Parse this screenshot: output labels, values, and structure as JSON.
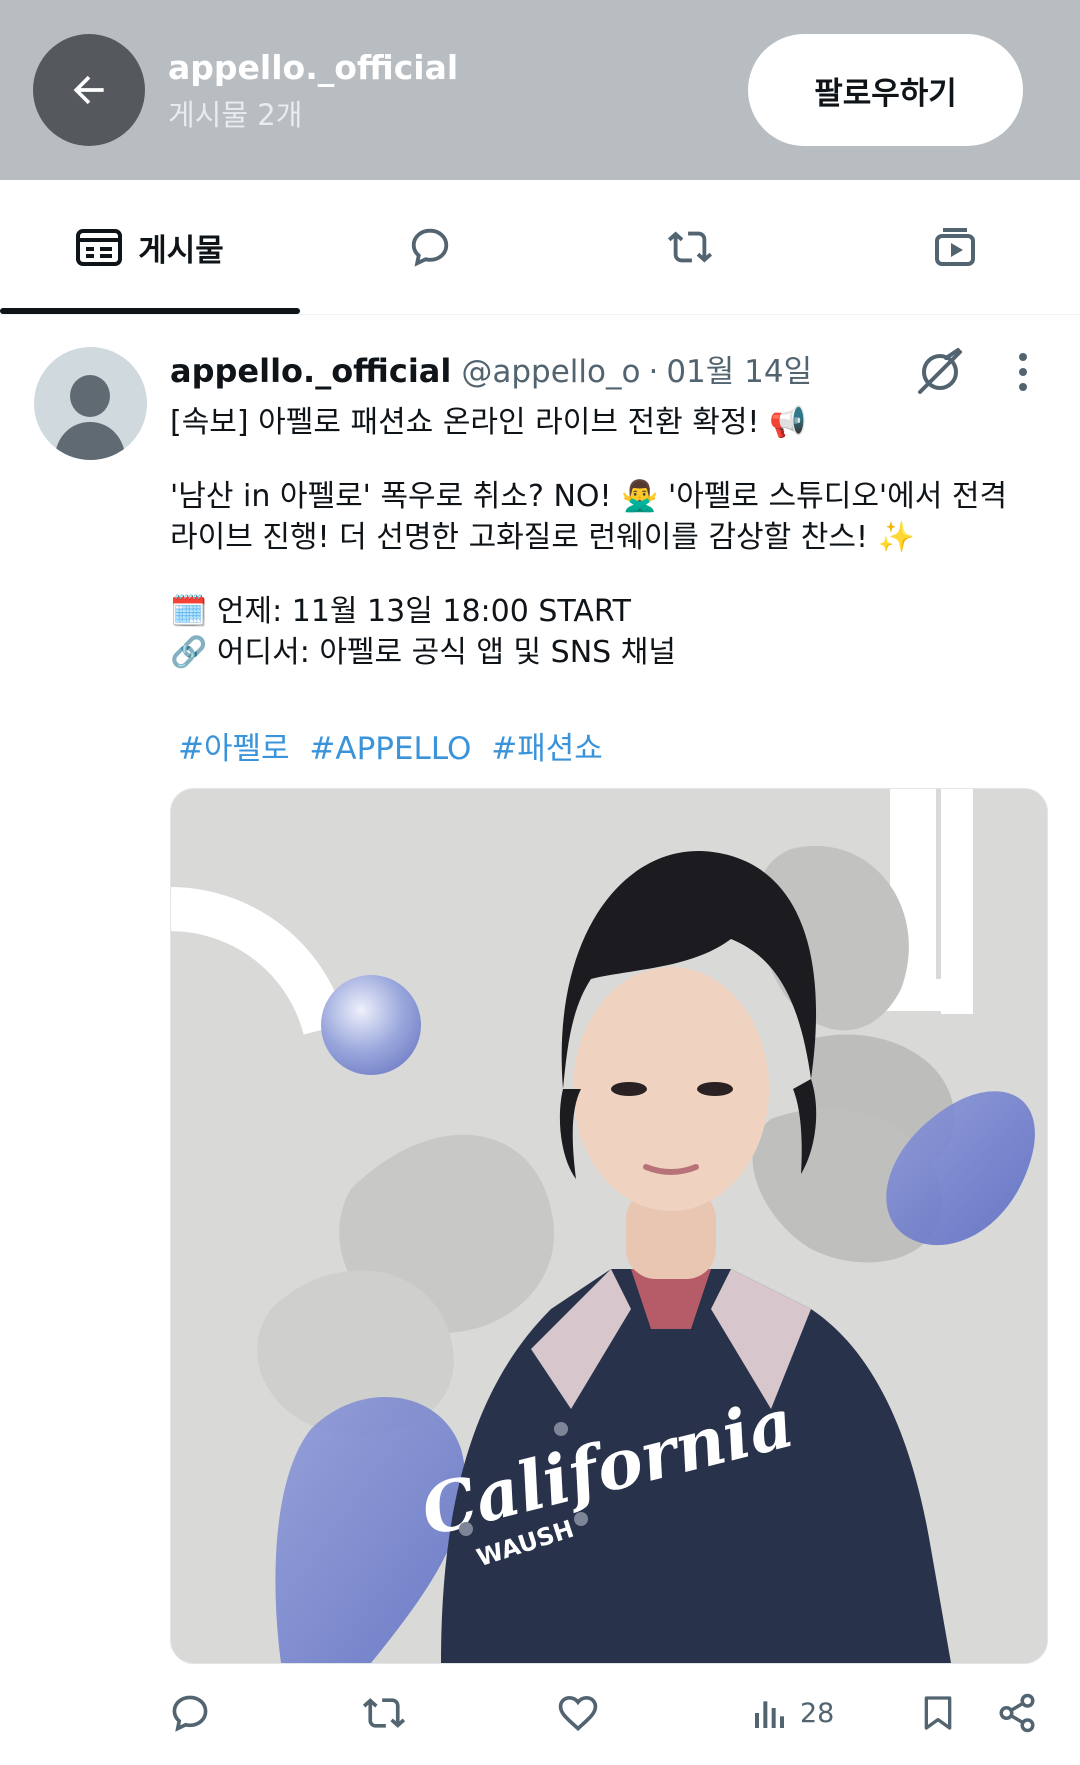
{
  "header": {
    "title": "appello._official",
    "subtitle": "게시물 2개",
    "follow_label": "팔로우하기"
  },
  "tabs": [
    {
      "label": "게시물",
      "icon": "posts-icon",
      "active": true
    },
    {
      "label": "",
      "icon": "replies-icon",
      "active": false
    },
    {
      "label": "",
      "icon": "retweet-icon",
      "active": false
    },
    {
      "label": "",
      "icon": "media-icon",
      "active": false
    }
  ],
  "post": {
    "author": "appello._official",
    "handle": "@appello_o",
    "separator": "·",
    "date": "01월 14일",
    "lines": [
      "[속보] 아펠로 패션쇼 온라인 라이브 전환 확정! 📢",
      "'남산 in 아펠로' 폭우로 취소? NO! 🙅‍♂️ '아펠로 스튜디오'에서 전격",
      "라이브 진행! 더 선명한 고화질로 런웨이를 감상할 찬스! ✨",
      "🗓️ 언제: 11월 13일 18:00 START",
      "🔗 어디서: 아펠로 공식 앱 및 SNS 채널"
    ],
    "hashtags": [
      "#아펠로",
      "#APPELLO",
      "#패션쇼"
    ],
    "media_logo_text": "California",
    "media_logo_sub": "WAUSH"
  },
  "actions": {
    "reply": "",
    "retweet": "",
    "like": "",
    "views": "28",
    "bookmark": "",
    "share": ""
  },
  "colors": {
    "header_bg": "#b8bdc1",
    "hashtag": "#3b94d9",
    "muted": "#536471"
  }
}
